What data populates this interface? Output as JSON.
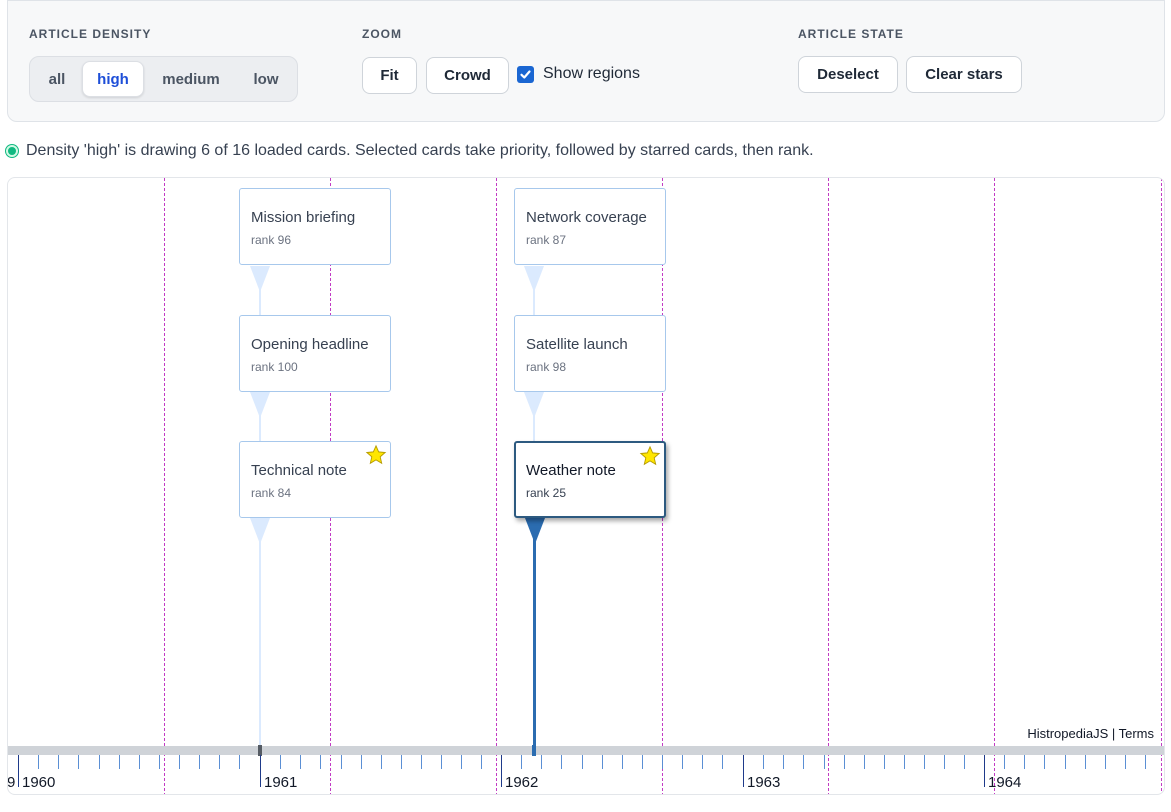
{
  "controls": {
    "density": {
      "label": "ARTICLE DENSITY",
      "options": [
        "all",
        "high",
        "medium",
        "low"
      ],
      "selected": "high"
    },
    "zoom": {
      "label": "ZOOM",
      "fit_label": "Fit",
      "crowd_label": "Crowd",
      "show_regions_label": "Show regions",
      "show_regions_checked": true
    },
    "article_state": {
      "label": "ARTICLE STATE",
      "deselect_label": "Deselect",
      "clear_stars_label": "Clear stars"
    }
  },
  "status": {
    "text": "Density 'high' is drawing 6 of 16 loaded cards. Selected cards take priority, followed by starred cards, then rank."
  },
  "cards": [
    {
      "title": "Mission briefing",
      "rank": "rank 96",
      "starred": false,
      "selected": false
    },
    {
      "title": "Opening headline",
      "rank": "rank 100",
      "starred": false,
      "selected": false
    },
    {
      "title": "Technical note",
      "rank": "rank 84",
      "starred": true,
      "selected": false
    },
    {
      "title": "Network coverage",
      "rank": "rank 87",
      "starred": false,
      "selected": false
    },
    {
      "title": "Satellite launch",
      "rank": "rank 98",
      "starred": false,
      "selected": false
    },
    {
      "title": "Weather note",
      "rank": "rank 25",
      "starred": true,
      "selected": true
    }
  ],
  "axis": {
    "years": [
      "1960",
      "1961",
      "1962",
      "1963",
      "1964"
    ],
    "partial_label": "9"
  },
  "attribution": "HistropediaJS | Terms",
  "colors": {
    "accent": "#1d4ed8",
    "region_line": "#c23bc4",
    "card_border": "#a7c8ec",
    "selected_border": "#2d5a80",
    "star": "#ffe600",
    "status_dot": "#10b981"
  }
}
